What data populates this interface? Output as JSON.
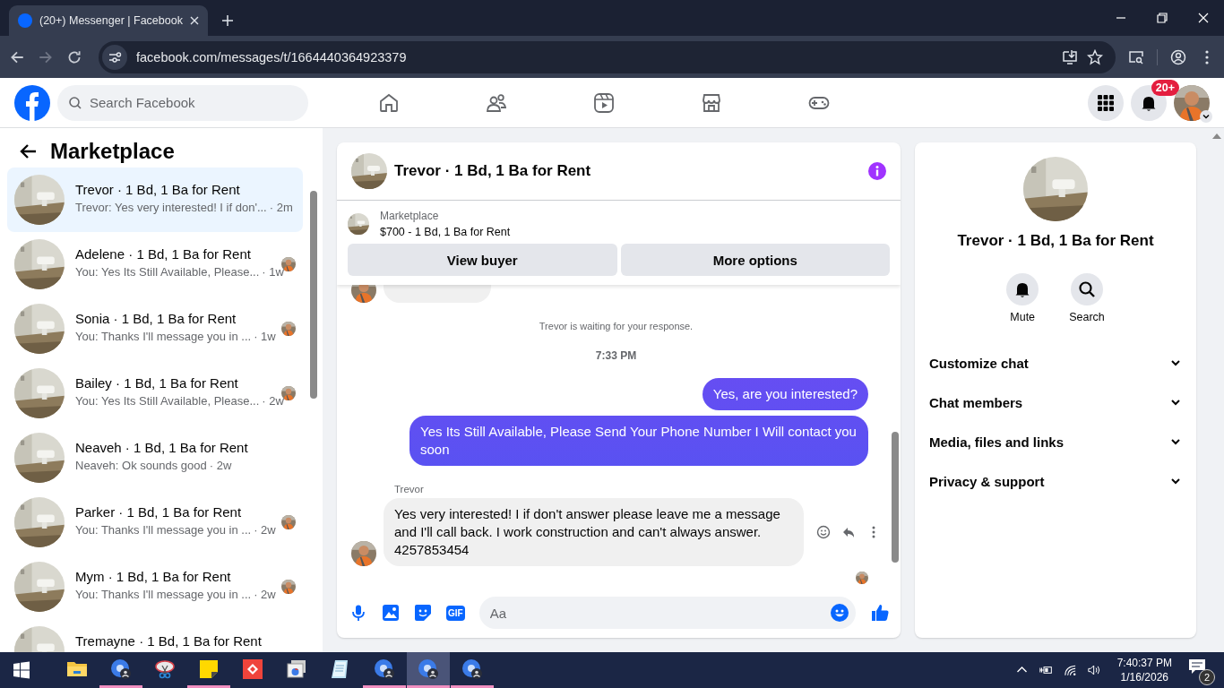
{
  "browser": {
    "tab_title": "(20+) Messenger | Facebook",
    "url": "facebook.com/messages/t/1664440364923379"
  },
  "header": {
    "search_placeholder": "Search Facebook",
    "notification_badge": "20+"
  },
  "sidebar": {
    "title": "Marketplace",
    "conversations": [
      {
        "name": "Trevor · 1 Bd, 1 Ba for Rent",
        "preview": "Trevor: Yes very interested! I if don'...",
        "time": "· 2m",
        "selected": true,
        "seen": false
      },
      {
        "name": "Adelene · 1 Bd, 1 Ba for Rent",
        "preview": "You: Yes Its Still Available, Please...",
        "time": "· 1w",
        "selected": false,
        "seen": true
      },
      {
        "name": "Sonia · 1 Bd, 1 Ba for Rent",
        "preview": "You: Thanks I'll message you in ...",
        "time": "· 1w",
        "selected": false,
        "seen": true
      },
      {
        "name": "Bailey · 1 Bd, 1 Ba for Rent",
        "preview": "You: Yes Its Still Available, Please...",
        "time": "· 2w",
        "selected": false,
        "seen": true
      },
      {
        "name": "Neaveh · 1 Bd, 1 Ba for Rent",
        "preview": "Neaveh: Ok sounds good",
        "time": "· 2w",
        "selected": false,
        "seen": false
      },
      {
        "name": "Parker · 1 Bd, 1 Ba for Rent",
        "preview": "You: Thanks I'll message you in ...",
        "time": "· 2w",
        "selected": false,
        "seen": true
      },
      {
        "name": "Mym · 1 Bd, 1 Ba for Rent",
        "preview": "You: Thanks I'll message you in ...",
        "time": "· 2w",
        "selected": false,
        "seen": true
      },
      {
        "name": "Tremayne · 1 Bd, 1 Ba for Rent",
        "selected": false,
        "seen": false
      }
    ]
  },
  "chat": {
    "title": "Trevor · 1 Bd, 1 Ba for Rent",
    "listing": {
      "label": "Marketplace",
      "price": "$700 - 1 Bd, 1 Ba for Rent"
    },
    "buttons": [
      "View buyer",
      "More options"
    ],
    "messages": [
      {
        "kind": "cut"
      },
      {
        "kind": "notice",
        "text": "Trevor is waiting for your response."
      },
      {
        "kind": "time",
        "text": "7:33 PM"
      },
      {
        "kind": "sent",
        "text": "Yes, are you interested?"
      },
      {
        "kind": "sent",
        "text": "Yes Its Still Available, Please Send Your Phone Number I Will contact you soon"
      },
      {
        "kind": "received",
        "sender": "Trevor",
        "text": "Yes very interested! I if don't answer please leave me a message and I'll call back. I work construction and can't always answer. 4257853454"
      },
      {
        "kind": "seen"
      }
    ],
    "composer": {
      "gif_label": "GIF",
      "placeholder": "Aa"
    }
  },
  "details": {
    "name": "Trevor · 1 Bd, 1 Ba for Rent",
    "actions": [
      {
        "kind": "mute",
        "label": "Mute"
      },
      {
        "kind": "search",
        "label": "Search"
      }
    ],
    "sections": [
      "Customize chat",
      "Chat members",
      "Media, files and links",
      "Privacy & support"
    ]
  },
  "taskbar": {
    "apps": [
      {
        "kind": "explorer",
        "running": false,
        "selected": false
      },
      {
        "kind": "chrome",
        "running": true,
        "selected": false
      },
      {
        "kind": "snip",
        "running": false,
        "selected": false
      },
      {
        "kind": "notes",
        "running": true,
        "selected": false
      },
      {
        "kind": "remote",
        "running": false,
        "selected": false
      },
      {
        "kind": "apps",
        "running": false,
        "selected": false
      },
      {
        "kind": "notepad",
        "running": false,
        "selected": false
      },
      {
        "kind": "chrome",
        "running": true,
        "selected": false
      },
      {
        "kind": "chrome",
        "running": true,
        "selected": true
      },
      {
        "kind": "chrome",
        "running": true,
        "selected": false
      }
    ],
    "time": "7:40:37 PM",
    "date": "1/16/2026",
    "notifications": "2"
  }
}
